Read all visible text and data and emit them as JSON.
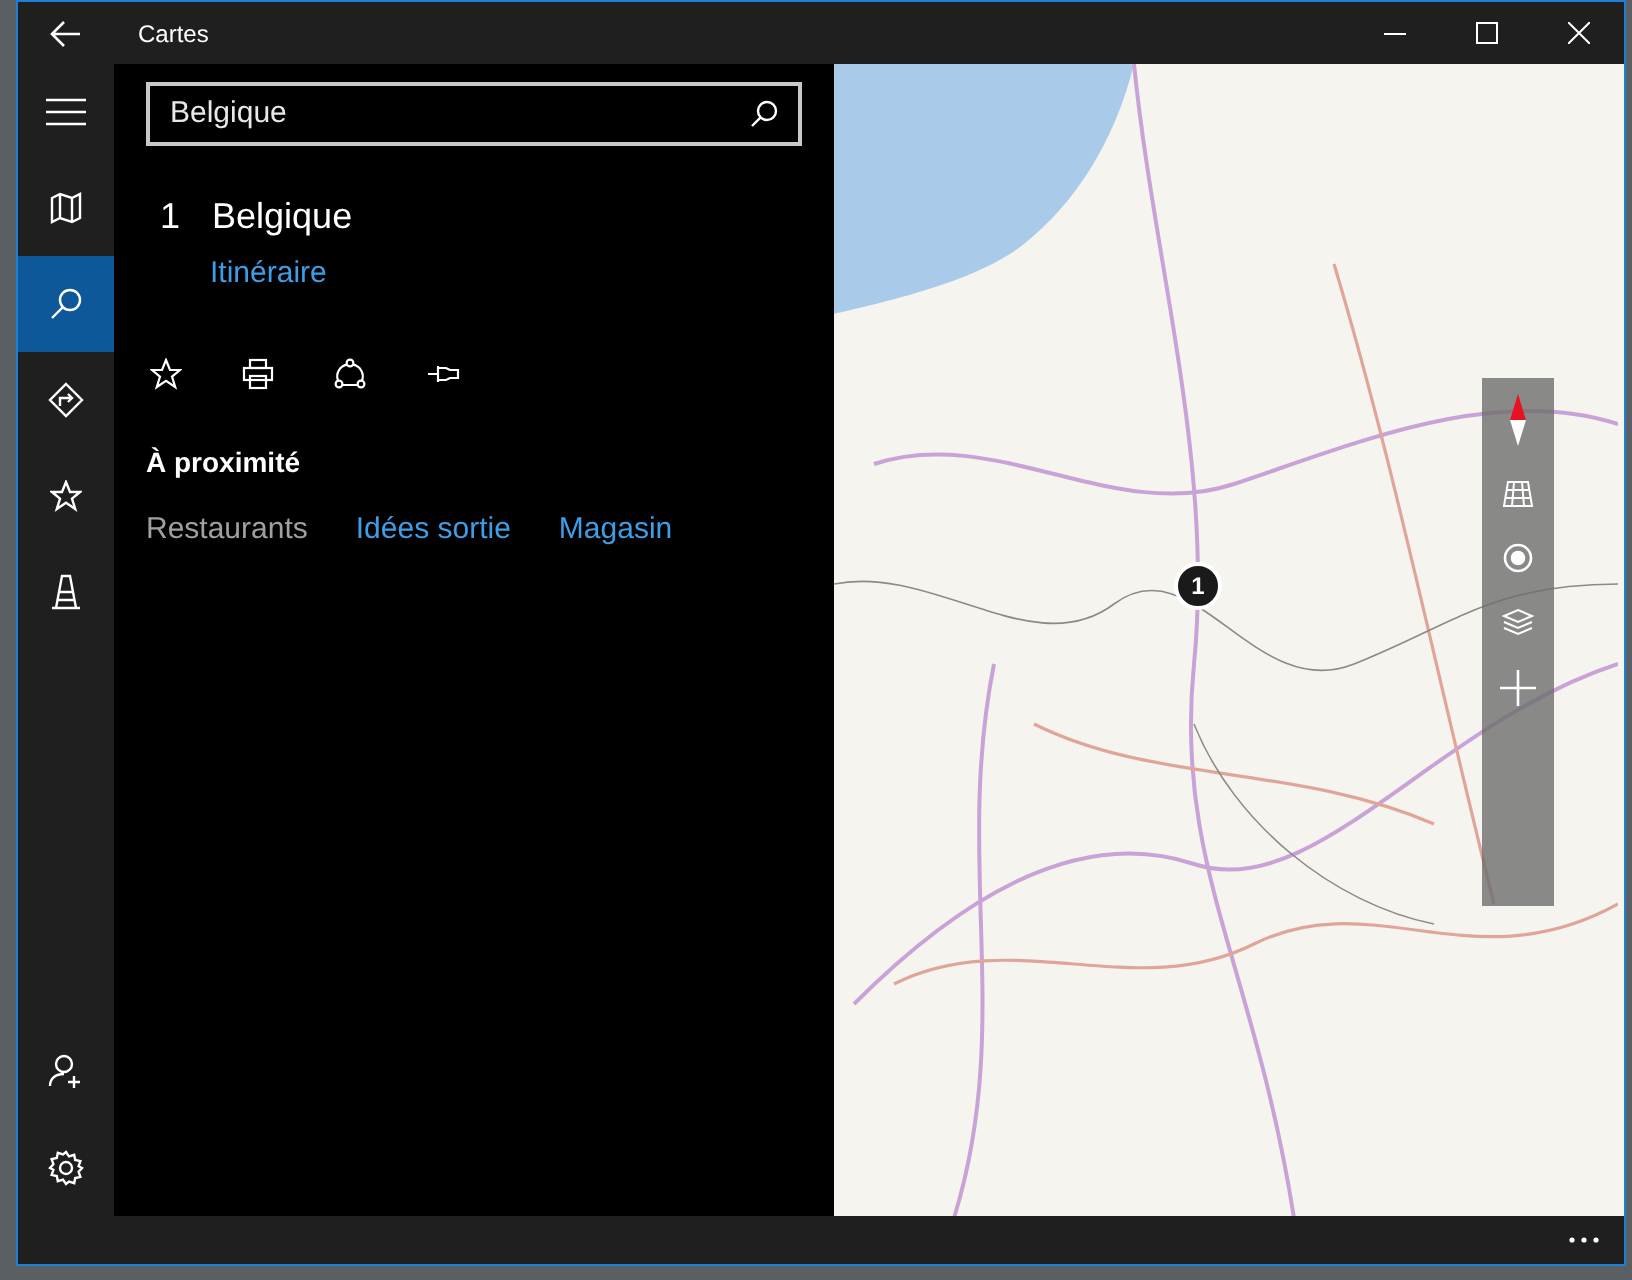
{
  "window": {
    "title": "Cartes"
  },
  "sidebar": {
    "items": [
      {
        "kind": "menu",
        "selected": false
      },
      {
        "kind": "map",
        "selected": false
      },
      {
        "kind": "search",
        "selected": true
      },
      {
        "kind": "directions",
        "selected": false
      },
      {
        "kind": "favorites",
        "selected": false
      },
      {
        "kind": "landmarks",
        "selected": false
      }
    ],
    "bottom_items": [
      {
        "kind": "account",
        "selected": false
      },
      {
        "kind": "settings",
        "selected": false
      }
    ]
  },
  "search": {
    "value": "Belgique"
  },
  "result": {
    "index": "1",
    "name": "Belgique",
    "link": "Itinéraire"
  },
  "nearby": {
    "heading": "À proximité",
    "categories": [
      {
        "label": "Restaurants",
        "selected": true
      },
      {
        "label": "Idées sortie",
        "selected": false
      },
      {
        "label": "Magasin",
        "selected": false
      }
    ]
  },
  "map": {
    "pin": "1"
  }
}
